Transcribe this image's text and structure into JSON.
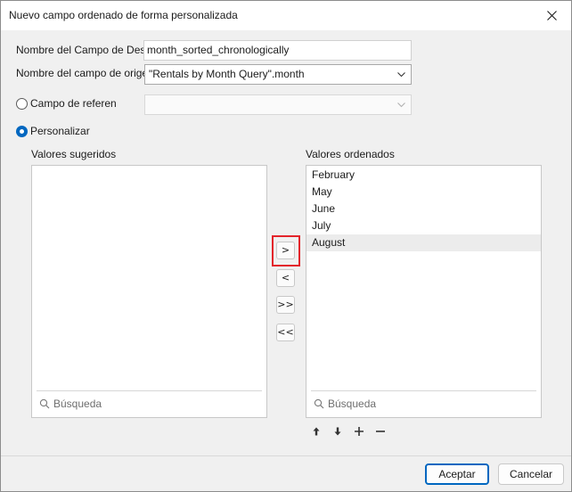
{
  "window": {
    "title": "Nuevo campo ordenado de forma personalizada"
  },
  "form": {
    "dest_field_label": "Nombre del Campo de Destino",
    "dest_field_value": "month_sorted_chronologically",
    "source_field_label": "Nombre del campo de origen",
    "source_field_value": "\"Rentals by Month Query\".month",
    "reference_field_label": "Campo de referencia",
    "reference_field_value": "",
    "custom_label": "Personalizar",
    "selected_mode": "custom"
  },
  "suggested": {
    "label": "Valores sugeridos",
    "items": [],
    "search_placeholder": "Búsqueda"
  },
  "ordered": {
    "label": "Valores ordenados",
    "items": [
      "February",
      "May",
      "June",
      "July",
      "August"
    ],
    "selected_item": "August",
    "search_placeholder": "Búsqueda"
  },
  "transfer_buttons": {
    "move_right": ">",
    "move_left": "<",
    "move_all_right": ">>",
    "move_all_left": "<<"
  },
  "footer": {
    "accept_label": "Aceptar",
    "cancel_label": "Cancelar"
  },
  "colors": {
    "accent": "#0067c0",
    "highlight": "#e3242b"
  }
}
